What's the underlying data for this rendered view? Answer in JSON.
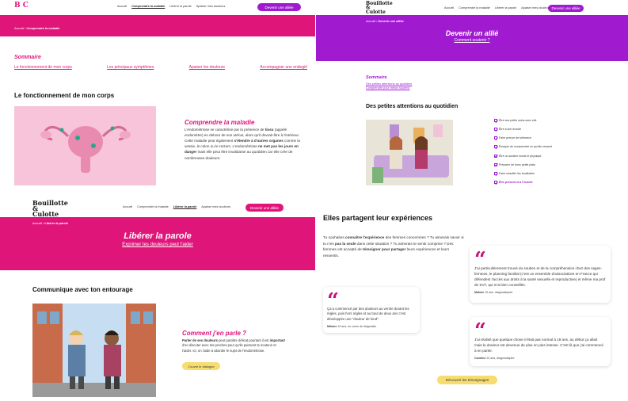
{
  "panel1": {
    "logo": "B C",
    "nav": [
      "Accueil",
      "Comprendre la maladie",
      "Libérer la parole",
      "Apaiser mes douleurs"
    ],
    "cta": "Devenir une alliée",
    "breadcrumb_home": "Accueil",
    "breadcrumb_current": "Comprendre la maladie",
    "sommaire_title": "Sommaire",
    "sommaire_links": [
      "Le fonctionnement de mon corps",
      "Les principaux symptômes",
      "Apaiser les douleurs",
      "Accompagner une endogirl"
    ],
    "section_title": "Le fonctionnement de mon corps",
    "card_title": "Comprendre la maladie",
    "card_text_1": "L'endométriose se caractérise par la présence de ",
    "card_bold_1": "tissu",
    "card_text_2": " (appelé endomètre) en dehors de son utérus, alors qu'il devrait être à l'intérieur. Cette maladie peut également ",
    "card_bold_2": "s'étendre à d'autres organes",
    "card_text_3": " comme la vessie, le colon ou le rectum. L'endométriose ",
    "card_bold_3": "ne met pas les jours en danger",
    "card_text_4": " mais elle peut être invalidante au quotidien car elle crée de nombreuses douleurs."
  },
  "panel2": {
    "logo": "Bouillotte & Culotte",
    "nav": [
      "Accueil",
      "Comprendre la maladie",
      "Libérer la parole",
      "Apaiser mes douleurs"
    ],
    "cta": "Devenir une alliée",
    "breadcrumb_home": "Accueil",
    "breadcrumb_current": "Devenir une alliée",
    "hero_title": "Devenir un allié",
    "hero_link": "Comment soutenir ?",
    "sommaire_title": "Sommaire",
    "sommaire_links": [
      "Des petites attentions au quotidien",
      "Comprendre pour mieux soutenir"
    ],
    "section_title": "Des petites attentions au quotidien",
    "checklist": [
      "Être aux petits soins avec elle",
      "Être à son écoute",
      "Faire preuve de tolérance",
      "Essayer de comprendre ce qu'elle ressent",
      "Être un soutien moral et physique",
      "Préparer de bons petits plats",
      "Faire chauffer les bouillottes",
      "Être présent et à l'écoute"
    ]
  },
  "panel3": {
    "logo": "Bouillotte & Culotte",
    "nav": [
      "Accueil",
      "Comprendre la maladie",
      "Libérer la parole",
      "Apaiser mes douleurs"
    ],
    "cta": "Devenir une alliée",
    "breadcrumb_home": "Accueil",
    "breadcrumb_current": "Libérer la parole",
    "hero_title": "Libérer la parole",
    "hero_link": "Exprimer tes douleurs peut t'aider",
    "section_title": "Communique avec ton entourage",
    "card_title": "Comment j'en parle ?",
    "card_bold_1": "Parler de ses douleurs",
    "card_text_1": " peut paraître délicat pourtant il est ",
    "card_bold_2": "important",
    "card_text_2": " d'en discuter avec tes proches pour qu'ils puissent te soutenir et t'aider. Ici, on t'aide à aborder le sujet de l'endométriose.",
    "card_button": "J'ouvre le dialogue"
  },
  "panel4": {
    "section_title": "Elles partagent leur expériences",
    "intro_1": "Tu souhaites ",
    "intro_b1": "connaître l'expérience",
    "intro_2": " des femmes concernées ? Tu aimerais savoir si tu n'es ",
    "intro_b2": "pas la seule",
    "intro_3": " dans cette situation ? Tu aimerais te sentir comprise ? Des femmes ont accepté de ",
    "intro_b3": "témoigner pour partager",
    "intro_4": " leurs expériences et leurs ressentis.",
    "testimonials": [
      {
        "text": "J'ai particulièrement trouvé du soutien et de la compréhension chez des sages-femmes, le planning familial (c'est un ensemble d'associations en France qui défendent l'accès aux droits à la santé sexuelle et reproductive) et même ma prof de SVT, qui m'a bien conseillée.",
        "name": "Maïmie",
        "meta": " 19 ans, diagnostiquée"
      },
      {
        "text": "Ça a commencé par des douleurs au ventre durant les règles, puis hors règles et au bout de deux ans c'est développée une \"douleur de fond\".",
        "name": "Mihane",
        "meta": " 19 ans, en cours de diagnostic"
      },
      {
        "text": "J'ai réalisé que quelque chose n'était pas normal à 19 ans, au début ça allait mais la douleur est devenue de plus en plus intense. C'est là que j'ai commencé à en parler.",
        "name": "Caroline",
        "meta": " 22 ans, diagnostiquée"
      }
    ],
    "button": "Découvrir les témoignages"
  },
  "colors": {
    "magenta": "#e0157a",
    "purple": "#a01bd0",
    "yellow": "#f7dc6f"
  }
}
